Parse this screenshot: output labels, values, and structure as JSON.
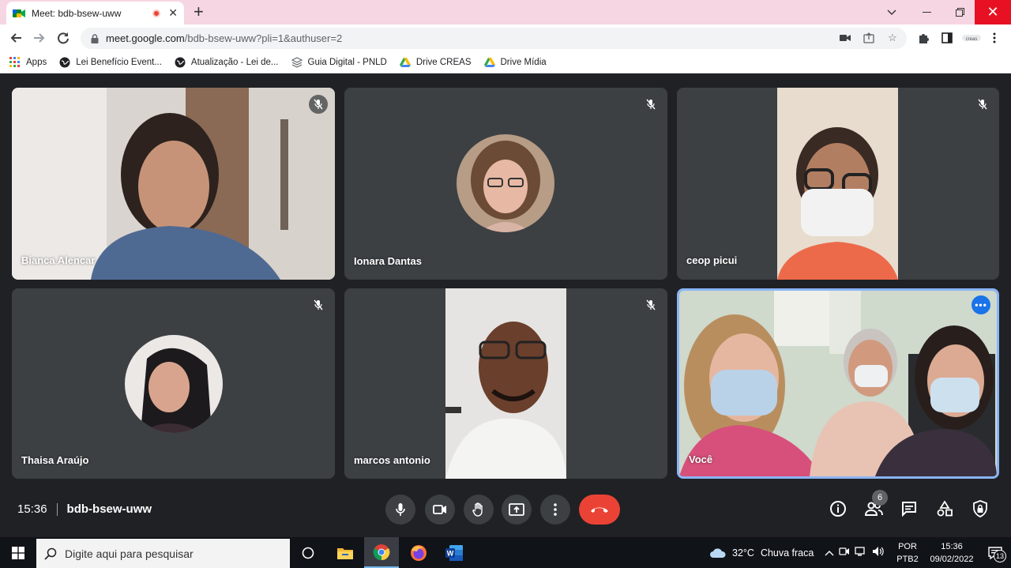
{
  "browser": {
    "tab": {
      "title": "Meet: bdb-bsew-uww",
      "recording_icon": "recording-dot",
      "close_icon": "close-icon"
    },
    "new_tab_icon": "plus-icon",
    "window_controls": [
      "minimize-icon",
      "maximize-icon",
      "close-icon"
    ],
    "address": {
      "host": "meet.google.com",
      "path": "/bdb-bsew-uww?pli=1&authuser=2"
    },
    "bookmarks": [
      {
        "label": "Apps",
        "icon": "apps-grid-icon"
      },
      {
        "label": "Lei Benefício Event...",
        "icon": "globe-icon"
      },
      {
        "label": "Atualização - Lei de...",
        "icon": "globe-icon"
      },
      {
        "label": "Guia Digital - PNLD",
        "icon": "layers-icon"
      },
      {
        "label": "Drive CREAS",
        "icon": "google-drive-icon"
      },
      {
        "label": "Drive Mídia",
        "icon": "google-drive-icon"
      }
    ]
  },
  "meet": {
    "participants": [
      {
        "name": "Bianca Alencar",
        "muted": true,
        "type": "video"
      },
      {
        "name": "Ionara Dantas",
        "muted": true,
        "type": "avatar"
      },
      {
        "name": "ceop picui",
        "muted": true,
        "type": "video"
      },
      {
        "name": "Thaisa Araújo",
        "muted": true,
        "type": "avatar"
      },
      {
        "name": "marcos antonio",
        "muted": true,
        "type": "video"
      },
      {
        "name": "Você",
        "muted": false,
        "type": "video",
        "active": true
      }
    ],
    "bar": {
      "time": "15:36",
      "meeting_code": "bdb-bsew-uww",
      "people_count": "6",
      "controls": [
        "microphone-icon",
        "camera-icon",
        "raise-hand-icon",
        "present-screen-icon",
        "more-options-icon",
        "hang-up-icon"
      ],
      "right_controls": [
        "info-icon",
        "people-icon",
        "chat-icon",
        "activities-icon",
        "host-controls-icon"
      ]
    },
    "colors": {
      "accent": "#8ab4f8",
      "hangup": "#ea4335",
      "tile_bg": "#3c4043",
      "page_bg": "#202124"
    }
  },
  "taskbar": {
    "search_placeholder": "Digite aqui para pesquisar",
    "weather": {
      "temp": "32°C",
      "condition": "Chuva fraca"
    },
    "lang": {
      "line1": "POR",
      "line2": "PTB2"
    },
    "clock": {
      "time": "15:36",
      "date": "09/02/2022"
    },
    "notifications": "13"
  }
}
